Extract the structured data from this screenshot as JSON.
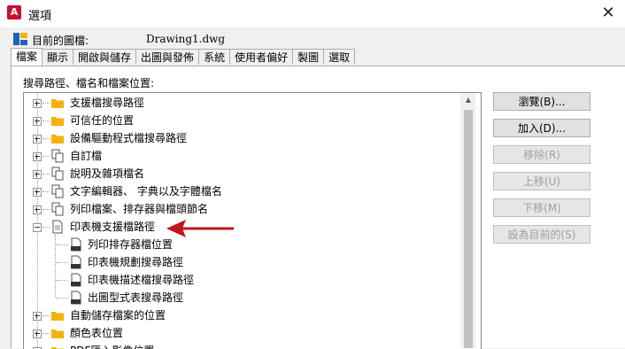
{
  "window": {
    "title": "選項",
    "app_icon_letter": "A"
  },
  "current_drawing": {
    "label": "目前的圖檔:",
    "value": "Drawing1.dwg"
  },
  "tabs": [
    {
      "label": "檔案"
    },
    {
      "label": "顯示"
    },
    {
      "label": "開啟與儲存"
    },
    {
      "label": "出圖與發佈"
    },
    {
      "label": "系統"
    },
    {
      "label": "使用者偏好"
    },
    {
      "label": "製圖"
    },
    {
      "label": "選取"
    }
  ],
  "active_tab": "檔案",
  "tree": {
    "heading": "搜尋路徑、檔名和檔案位置:",
    "items": [
      {
        "label": "支援檔搜尋路徑"
      },
      {
        "label": "可信任的位置"
      },
      {
        "label": "設備驅動程式檔搜尋路徑"
      },
      {
        "label": "自訂檔"
      },
      {
        "label": "說明及雜項檔名"
      },
      {
        "label": "文字編輯器、 字典以及字體檔名"
      },
      {
        "label": "列印檔案、排存器與檔頭節名"
      },
      {
        "label": "印表機支援檔路徑"
      },
      {
        "label": "列印排存器檔位置"
      },
      {
        "label": "印表機規劃搜尋路徑"
      },
      {
        "label": "印表機描述檔搜尋路徑"
      },
      {
        "label": "出圖型式表搜尋路徑"
      },
      {
        "label": "自動儲存檔案的位置"
      },
      {
        "label": "顏色表位置"
      },
      {
        "label": "PDF匯入影像位置"
      }
    ]
  },
  "buttons": {
    "browse": "瀏覽(B)...",
    "add": "加入(D)...",
    "remove": "移除(R)",
    "move_up": "上移(U)",
    "move_down": "下移(M)",
    "set_current": "設為目前的(S)"
  },
  "colors": {
    "folder": "#f4b30a",
    "arrow": "#c0161c",
    "app_icon": "#c8102e"
  }
}
